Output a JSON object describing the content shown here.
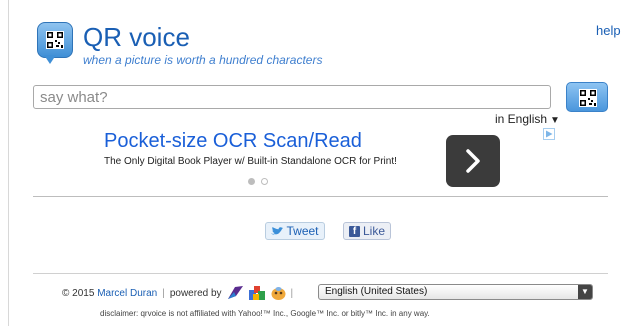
{
  "header": {
    "title": "QR voice",
    "tagline": "when a picture is worth a hundred characters",
    "help_label": "help"
  },
  "input": {
    "placeholder": "say what?",
    "value": ""
  },
  "language": {
    "label": "in English"
  },
  "ad": {
    "title": "Pocket-size OCR Scan/Read",
    "description": "The Only Digital Book Player w/ Built-in Standalone OCR for Print!"
  },
  "social": {
    "tweet_label": "Tweet",
    "like_label": "Like"
  },
  "footer": {
    "copyright": "© 2015",
    "author": "Marcel Duran",
    "powered_by": "powered by",
    "locale": "English (United States)",
    "disclaimer": "disclaimer: qrvoice is not affiliated with Yahoo!™ Inc., Google™ Inc. or bitly™ Inc. in any way."
  },
  "colors": {
    "brand_blue": "#1a5fb4",
    "button_blue": "#4a96dc"
  },
  "icons": [
    "qr-code-icon",
    "caret-down-icon",
    "chevron-right-icon",
    "ad-choices-icon",
    "twitter-bird-icon",
    "facebook-icon",
    "yahoo-icon",
    "google-icon",
    "bitly-icon"
  ]
}
